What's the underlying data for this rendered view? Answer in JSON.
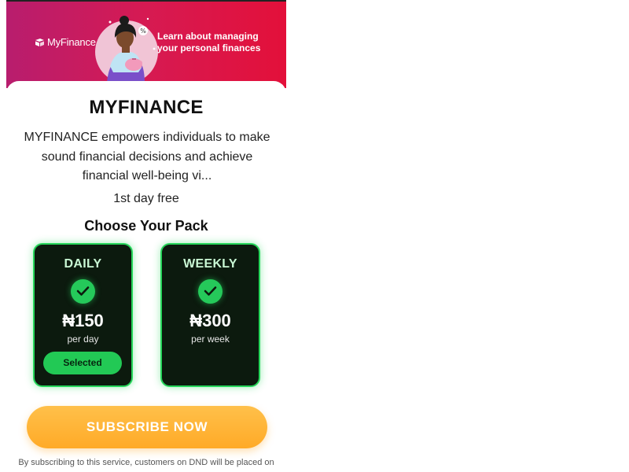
{
  "banner": {
    "logo_text": "MyFinance",
    "headline_line1": "Learn about managing",
    "headline_line2": "your personal finances",
    "gradient_colors": [
      "#b81d6e",
      "#e3103a"
    ]
  },
  "service": {
    "title": "MYFINANCE",
    "description": "MYFINANCE empowers individuals to make sound financial decisions and achieve financial well-being vi...",
    "trial": "1st day free"
  },
  "packs": {
    "heading": "Choose Your Pack",
    "items": [
      {
        "name": "DAILY",
        "price": "₦150",
        "period": "per day",
        "selected": true,
        "selected_label": "Selected"
      },
      {
        "name": "WEEKLY",
        "price": "₦300",
        "period": "per week",
        "selected": false
      }
    ],
    "accent_color": "#26d65a",
    "card_bg": "#0c1a0e"
  },
  "cta": {
    "label": "SUBSCRIBE NOW",
    "color": "#ffb232"
  },
  "footer": {
    "terms": "By subscribing to this service, customers on DND will be placed on"
  },
  "icons": [
    "logo-mark-icon",
    "check-icon",
    "percent-icon"
  ]
}
